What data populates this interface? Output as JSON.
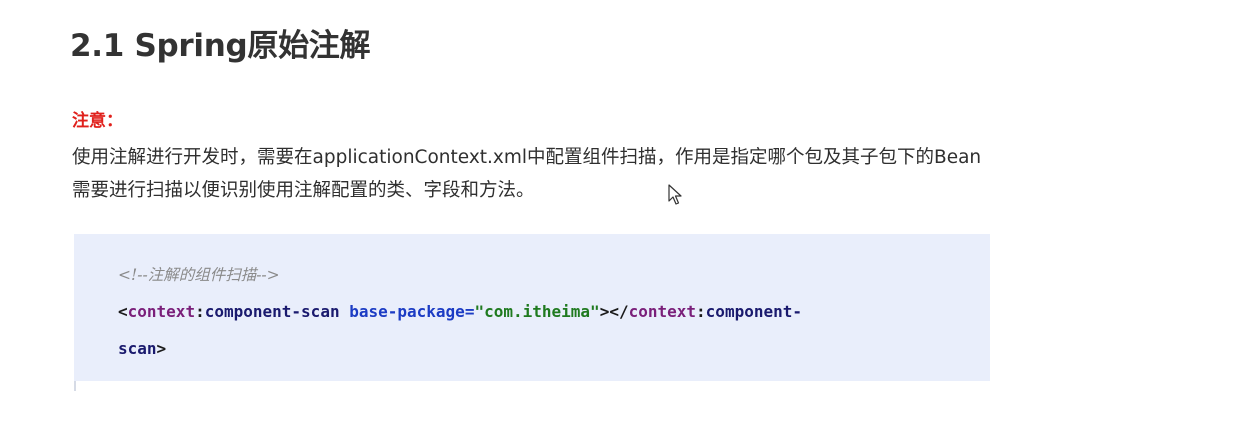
{
  "heading": {
    "title": "2.1 Spring原始注解"
  },
  "note": {
    "label": "注意：",
    "line1": "使用注解进行开发时，需要在applicationContext.xml中配置组件扫描，作用是指定哪个包及其子包下的Bean",
    "line2": "需要进行扫描以便识别使用注解配置的类、字段和方法。"
  },
  "code": {
    "comment": "<!--注解的组件扫描-->",
    "line2": {
      "open_lt": "<",
      "ns1": "context",
      "colon1": ":",
      "tag1": "component-scan",
      "space": " ",
      "attr": "base-package",
      "eq": "=",
      "value": "\"com.itheima\"",
      "gt_lt": "></",
      "ns2": "context",
      "colon2": ":",
      "tag2": "component-"
    },
    "line3": {
      "tag3": "scan",
      "close_gt": ">"
    }
  },
  "colors": {
    "note_red": "#e0201b",
    "code_bg": "#e9eefb",
    "namespace": "#7a1f7a",
    "attribute": "#1c3cc4",
    "attr_value": "#1f7a1f"
  },
  "icons": {
    "cursor": "mouse-pointer-icon"
  }
}
